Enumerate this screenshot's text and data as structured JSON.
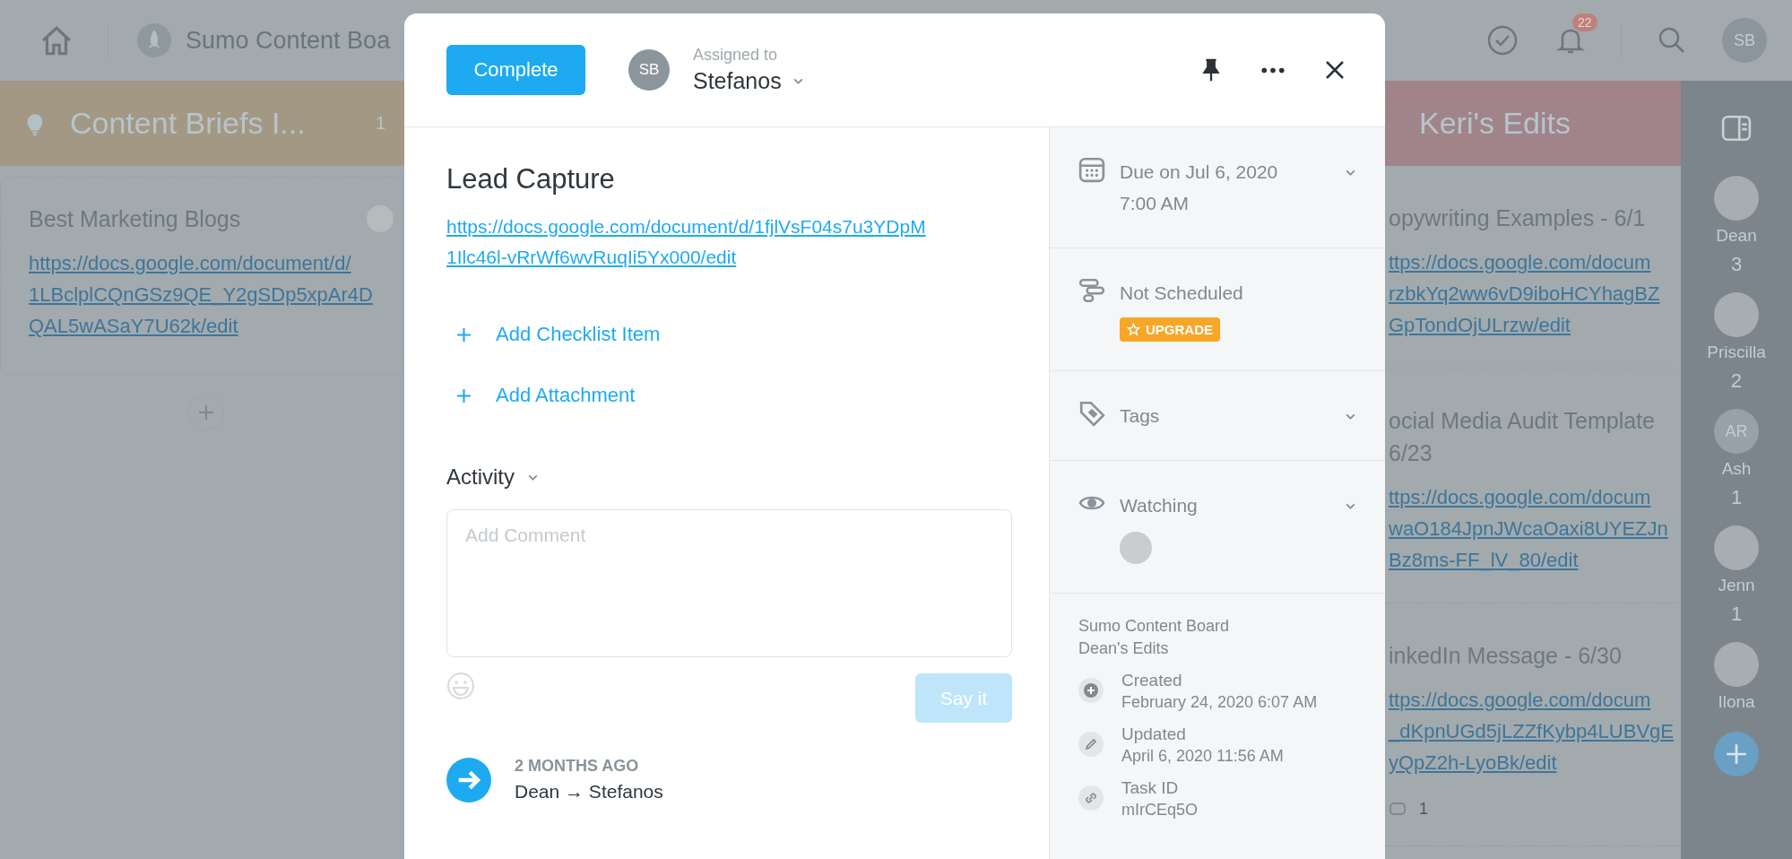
{
  "top_bar": {
    "board_title": "Sumo Content Boa",
    "notification_count": "22",
    "user_initials": "SB"
  },
  "left_column": {
    "title": "Content Briefs I...",
    "count": "1",
    "color": "#a39884",
    "cards": [
      {
        "title": "Best Marketing Blogs",
        "link_lines": [
          "https://docs.google.com/document/d/",
          "1LBclplCQnGSz9QE_Y2gSDp5xpAr4D",
          "QAL5wASaY7U62k/edit"
        ]
      }
    ]
  },
  "right_column": {
    "title": "Keri's Edits",
    "color": "#a0848a",
    "cards": [
      {
        "title_lines": [
          "opywriting Examples - 6/1"
        ],
        "link_lines": [
          "ttps://docs.google.com/docum",
          "rzbkYq2ww6vD9iboHCYhagBZ",
          "GpTondOjULrzw/edit"
        ]
      },
      {
        "title_lines": [
          "ocial Media Audit Template",
          "6/23"
        ],
        "link_lines": [
          "ttps://docs.google.com/docum",
          "waO184JpnJWcaOaxi8UYEZJn",
          "Bz8ms-FF_lV_80/edit"
        ]
      },
      {
        "title_lines": [
          "inkedIn Message - 6/30"
        ],
        "link_lines": [
          "ttps://docs.google.com/docum",
          "_dKpnUGd5jLZZfKybp4LUBVgE",
          "yQpZ2h-LyoBk/edit"
        ],
        "comment_count": "1"
      }
    ]
  },
  "members": [
    {
      "kind": "photo",
      "name": "Dean",
      "count": "3"
    },
    {
      "kind": "photo",
      "name": "Priscilla",
      "count": "2"
    },
    {
      "kind": "initials",
      "initials": "AR",
      "name": "Ash",
      "count": "1"
    },
    {
      "kind": "photo",
      "name": "Jenn",
      "count": "1"
    },
    {
      "kind": "photo",
      "name": "Ilona"
    }
  ],
  "modal": {
    "complete_button": "Complete",
    "assignee_initials": "SB",
    "assigned_label": "Assigned to",
    "assignee": "Stefanos",
    "title": "Lead Capture",
    "link_lines": [
      "https://docs.google.com/document/d/1fjlVsF04s7u3YDpM",
      "1Ilc46l-vRrWf6wvRuqIi5Yx000/edit"
    ],
    "actions": [
      "Add Checklist Item",
      "Add Attachment"
    ],
    "activity_heading": "Activity",
    "comment": {
      "placeholder": "Add Comment",
      "submit": "Say it",
      "disabled": true
    },
    "activity": [
      {
        "time": "2 MONTHS AGO",
        "text": "Dean → Stefanos"
      }
    ],
    "sections": [
      {
        "kind": "due",
        "lines": [
          "Due on Jul 6, 2020",
          "7:00 AM"
        ]
      },
      {
        "kind": "schedule",
        "lines": [
          "Not Scheduled"
        ],
        "badge": "UPGRADE"
      },
      {
        "kind": "tags",
        "lines": [
          "Tags"
        ]
      },
      {
        "kind": "watching",
        "lines": [
          "Watching"
        ]
      }
    ],
    "board": "Sumo Content Board",
    "list": "Dean's Edits",
    "meta": [
      {
        "kind": "created",
        "label": "Created",
        "value": "February 24, 2020 6:07 AM"
      },
      {
        "kind": "updated",
        "label": "Updated",
        "value": "April 6, 2020 11:56 AM"
      },
      {
        "kind": "task_id",
        "label": "Task ID",
        "value": "mIrCEq5O"
      }
    ]
  }
}
